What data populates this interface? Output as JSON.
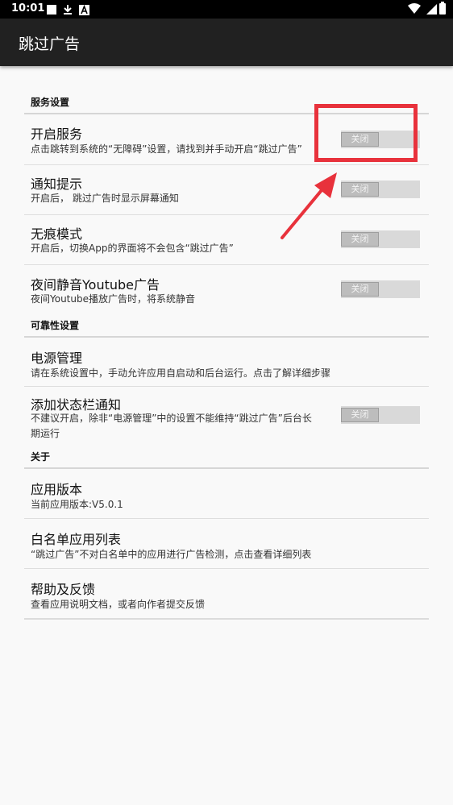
{
  "status_bar": {
    "time": "10:01",
    "icons": [
      "notification-square-icon",
      "download-icon",
      "font-a-icon",
      "wifi-icon",
      "battery-icon"
    ]
  },
  "app": {
    "title": "跳过广告"
  },
  "sections": {
    "service": {
      "header": "服务设置",
      "enable_service": {
        "title": "开启服务",
        "summary": "点击跳转到系统的“无障碍”设置，请找到并手动开启“跳过广告”",
        "switch": "关闭"
      },
      "notify": {
        "title": "通知提示",
        "summary": "开启后， 跳过广告时显示屏幕通知",
        "switch": "关闭"
      },
      "incognito": {
        "title": "无痕模式",
        "summary": "开启后，切换App的界面将不会包含“跳过广告”",
        "switch": "关闭"
      },
      "mute_youtube": {
        "title": "夜间静音Youtube广告",
        "summary": "夜间Youtube播放广告时，将系统静音",
        "switch": "关闭"
      }
    },
    "reliability": {
      "header": "可靠性设置",
      "power": {
        "title": "电源管理",
        "summary": "请在系统设置中，手动允许应用自启动和后台运行。点击了解详细步骤"
      },
      "statusbar_notify": {
        "title": "添加状态栏通知",
        "summary_line1": "不建议开启，除非“电源管理”中的设置不能维持“跳过广告”后台长",
        "summary_line2": "期运行",
        "switch": "关闭"
      }
    },
    "about": {
      "header": "关于",
      "version": {
        "title": "应用版本",
        "summary": "当前应用版本:V5.0.1"
      },
      "whitelist": {
        "title": "白名单应用列表",
        "summary": "“跳过广告”不对白名单中的应用进行广告检测，点击查看详细列表"
      },
      "help": {
        "title": "帮助及反馈",
        "summary": "查看应用说明文档，或者向作者提交反馈"
      }
    }
  },
  "colors": {
    "annotation": "#e8323c",
    "appbar": "#212121",
    "background": "#f9f9f9"
  }
}
